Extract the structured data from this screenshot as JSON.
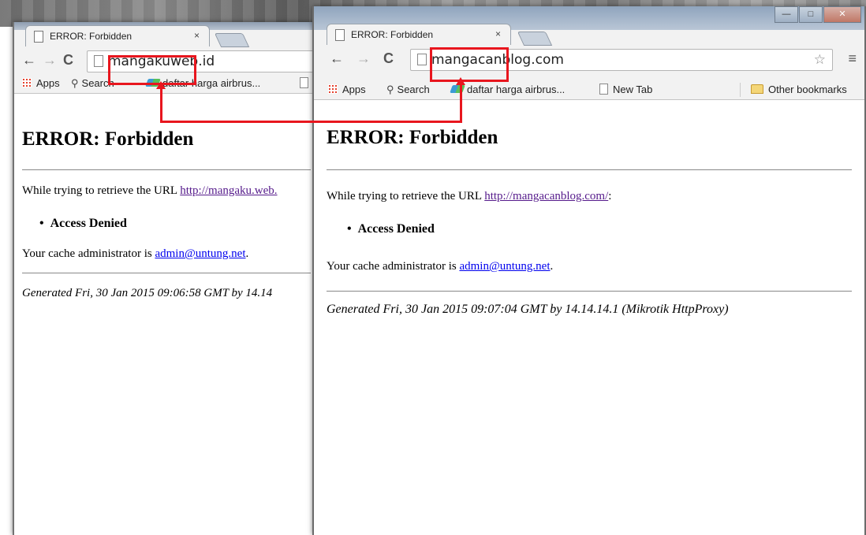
{
  "left_window": {
    "tab_title": "ERROR: Forbidden",
    "tab_close": "×",
    "nav_back": "←",
    "nav_forward": "→",
    "nav_reload": "C",
    "url_highlight": "mangaku",
    "url_rest": "web.id",
    "bookmarks": {
      "apps": "Apps",
      "search": "Search",
      "daftar": "daftar harga airbrus..."
    },
    "page": {
      "heading": "ERROR: Forbidden",
      "retrieve_prefix": "While trying to retrieve the URL ",
      "retrieve_link": "http://mangaku.web.",
      "bullet": "Access Denied",
      "admin_prefix": "Your cache administrator is ",
      "admin_email": "admin@untung.net",
      "admin_suffix": ".",
      "generated": "Generated Fri, 30 Jan 2015 09:06:58 GMT by 14.14"
    }
  },
  "right_window": {
    "tab_title": "ERROR: Forbidden",
    "tab_close": "×",
    "window_controls": {
      "minimize": "—",
      "maximize": "□",
      "close": "✕"
    },
    "nav_back": "←",
    "nav_forward": "→",
    "nav_reload": "C",
    "url_highlight": "mangacan",
    "url_rest": "blog.com",
    "star": "☆",
    "menu": "≡",
    "bookmarks": {
      "apps": "Apps",
      "search": "Search",
      "daftar": "daftar harga airbrus...",
      "new_tab": "New Tab",
      "other": "Other bookmarks"
    },
    "page": {
      "heading": "ERROR: Forbidden",
      "retrieve_prefix": "While trying to retrieve the URL ",
      "retrieve_link": "http://mangacanblog.com/",
      "retrieve_suffix": ":",
      "bullet": "Access Denied",
      "admin_prefix": "Your cache administrator is ",
      "admin_email": "admin@untung.net",
      "admin_suffix": ".",
      "generated": "Generated Fri, 30 Jan 2015 09:07:04 GMT by 14.14.14.1 (Mikrotik HttpProxy)"
    }
  },
  "annotation": {
    "color": "#e8161e"
  }
}
